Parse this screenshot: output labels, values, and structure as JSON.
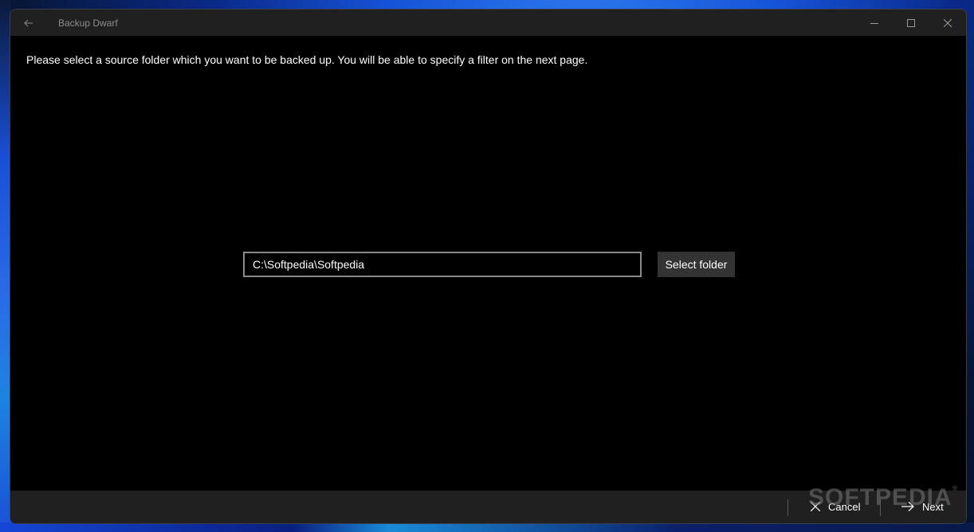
{
  "window": {
    "title": "Backup Dwarf",
    "controls": [
      "minimize",
      "maximize",
      "close"
    ]
  },
  "page": {
    "instruction": "Please select a source folder which you want to be backed up. You will be able to specify a filter on the next page.",
    "source_folder": {
      "value": "C:\\Softpedia\\Softpedia",
      "placeholder": ""
    },
    "select_folder_label": "Select folder"
  },
  "footer": {
    "cancel_label": "Cancel",
    "next_label": "Next"
  },
  "watermark": {
    "text": "SOFTPEDIA",
    "mark": "®"
  },
  "colors": {
    "titlebar_bg": "#202020",
    "content_bg": "#000000",
    "button_bg": "#333333",
    "text": "#ffffff",
    "muted_text": "#8c8c8c"
  }
}
